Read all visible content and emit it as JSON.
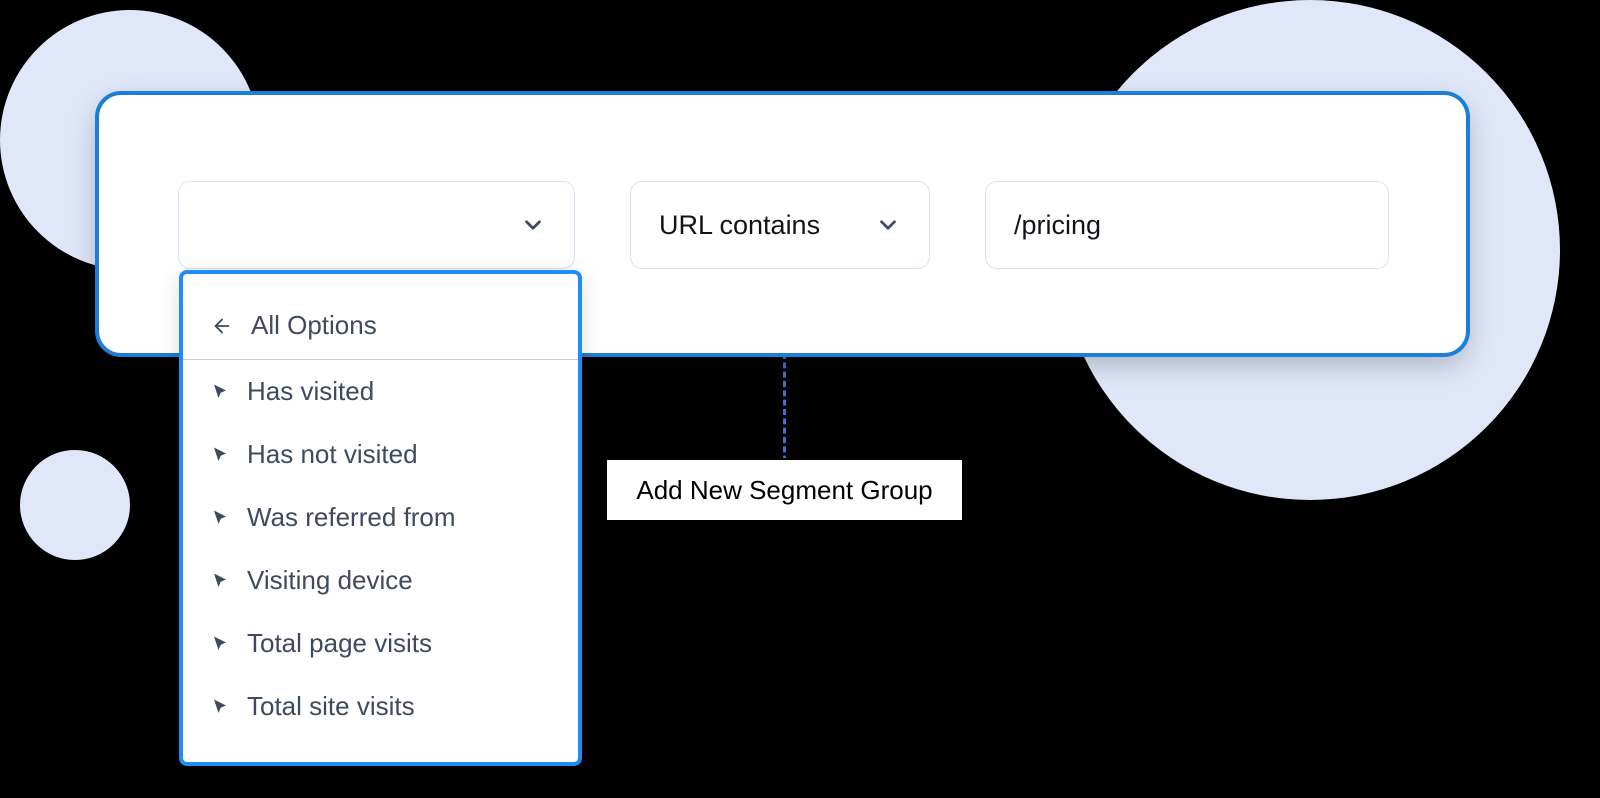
{
  "segment": {
    "condition_dropdown": {
      "selected": ""
    },
    "operator_dropdown": {
      "selected": "URL contains"
    },
    "value_input": {
      "value": "/pricing"
    }
  },
  "dropdown": {
    "header": "All Options",
    "items": [
      "Has visited",
      "Has not visited",
      "Was referred from",
      "Visiting device",
      "Total page visits",
      "Total site visits"
    ]
  },
  "add_group_button": "Add New Segment Group"
}
